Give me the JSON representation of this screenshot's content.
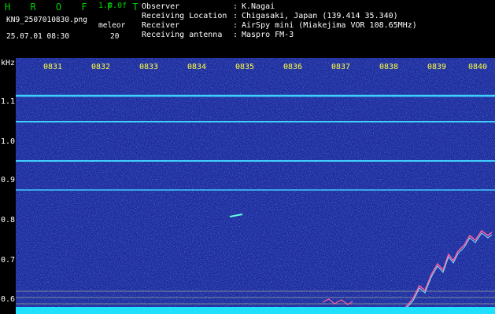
{
  "header": {
    "app_name": "H R O F F T",
    "version": "1.0.0f",
    "file_name": "KN9_2507010830.png",
    "mode_label": "meleor",
    "datetime": "25.07.01 08:30",
    "count": "20",
    "info": [
      {
        "label": "Observer",
        "value": "K.Nagai"
      },
      {
        "label": "Receiving Location",
        "value": "Chigasaki, Japan (139.414 35.340)"
      },
      {
        "label": "Receiver",
        "value": "AirSpy mini (Miakejima VOR 108.65MHz)"
      },
      {
        "label": "Receiving antenna",
        "value": "Maspro FM-3"
      }
    ]
  },
  "spectrogram": {
    "y_unit": "kHz",
    "time_ticks": [
      "0831",
      "0832",
      "0833",
      "0834",
      "0835",
      "0836",
      "0837",
      "0838",
      "0839",
      "0840"
    ],
    "freq_ticks": [
      "1.1",
      "1.0",
      "0.9",
      "0.8",
      "0.7",
      "0.6"
    ],
    "colors": {
      "background": "#1c2a9a",
      "signal": "#40d0ff",
      "tick": "#ffff40"
    }
  }
}
